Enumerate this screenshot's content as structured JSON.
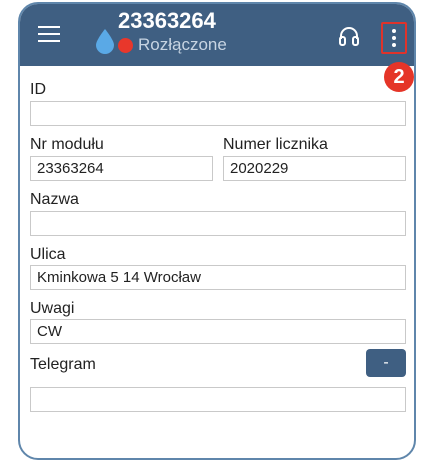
{
  "header": {
    "title": "23363264",
    "status": "Rozłączone",
    "status_color": "#e8372b",
    "bar_color": "#3f5f82",
    "badge": "2",
    "icons": [
      "menu-icon",
      "water-drop-icon",
      "headset-icon",
      "more-vert-icon"
    ]
  },
  "form": {
    "id_label": "ID",
    "id_value": "",
    "module_label": "Nr modułu",
    "module_value": "23363264",
    "meter_label": "Numer licznika",
    "meter_value": "2020229",
    "name_label": "Nazwa",
    "name_value": "",
    "street_label": "Ulica",
    "street_value": "Kminkowa 5 14 Wrocław",
    "notes_label": "Uwagi",
    "notes_value": "CW",
    "telegram_label": "Telegram",
    "telegram_button": "-",
    "telegram_value": ""
  }
}
